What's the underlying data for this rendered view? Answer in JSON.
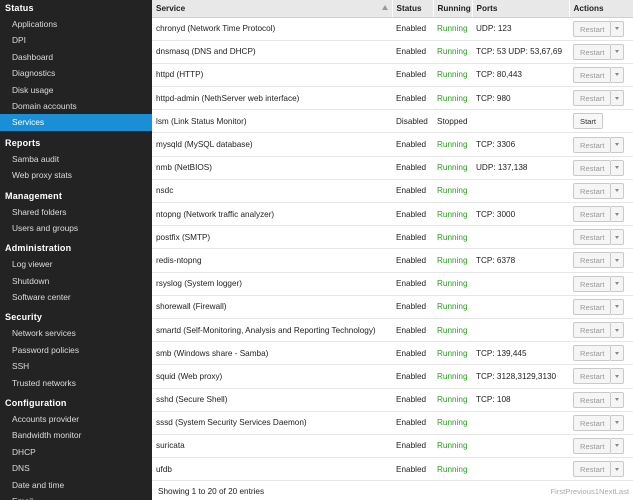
{
  "sidebar": {
    "sections": [
      {
        "title": "Status",
        "items": [
          {
            "label": "Applications"
          },
          {
            "label": "DPI"
          },
          {
            "label": "Dashboard"
          },
          {
            "label": "Diagnostics"
          },
          {
            "label": "Disk usage"
          },
          {
            "label": "Domain accounts"
          },
          {
            "label": "Services",
            "active": true
          }
        ]
      },
      {
        "title": "Reports",
        "items": [
          {
            "label": "Samba audit"
          },
          {
            "label": "Web proxy stats"
          }
        ]
      },
      {
        "title": "Management",
        "items": [
          {
            "label": "Shared folders"
          },
          {
            "label": "Users and groups"
          }
        ]
      },
      {
        "title": "Administration",
        "items": [
          {
            "label": "Log viewer"
          },
          {
            "label": "Shutdown"
          },
          {
            "label": "Software center"
          }
        ]
      },
      {
        "title": "Security",
        "items": [
          {
            "label": "Network services"
          },
          {
            "label": "Password policies"
          },
          {
            "label": "SSH"
          },
          {
            "label": "Trusted networks"
          }
        ]
      },
      {
        "title": "Configuration",
        "items": [
          {
            "label": "Accounts provider"
          },
          {
            "label": "Bandwidth monitor"
          },
          {
            "label": "DHCP"
          },
          {
            "label": "DNS"
          },
          {
            "label": "Date and time"
          },
          {
            "label": "Email"
          }
        ]
      }
    ]
  },
  "table": {
    "headers": {
      "service": "Service",
      "status": "Status",
      "running": "Running",
      "ports": "Ports",
      "actions": "Actions"
    },
    "rows": [
      {
        "service": "chronyd (Network Time Protocol)",
        "status": "Enabled",
        "running": "Running",
        "ports": "UDP: 123",
        "action": "Restart"
      },
      {
        "service": "dnsmasq (DNS and DHCP)",
        "status": "Enabled",
        "running": "Running",
        "ports": "TCP: 53 UDP: 53,67,69",
        "action": "Restart"
      },
      {
        "service": "httpd (HTTP)",
        "status": "Enabled",
        "running": "Running",
        "ports": "TCP: 80,443",
        "action": "Restart"
      },
      {
        "service": "httpd-admin (NethServer web interface)",
        "status": "Enabled",
        "running": "Running",
        "ports": "TCP: 980",
        "action": "Restart"
      },
      {
        "service": "lsm (Link Status Monitor)",
        "status": "Disabled",
        "running": "Stopped",
        "ports": "",
        "action": "Start"
      },
      {
        "service": "mysqld (MySQL database)",
        "status": "Enabled",
        "running": "Running",
        "ports": "TCP: 3306",
        "action": "Restart"
      },
      {
        "service": "nmb (NetBIOS)",
        "status": "Enabled",
        "running": "Running",
        "ports": "UDP: 137,138",
        "action": "Restart"
      },
      {
        "service": "nsdc",
        "status": "Enabled",
        "running": "Running",
        "ports": "",
        "action": "Restart"
      },
      {
        "service": "ntopng (Network traffic analyzer)",
        "status": "Enabled",
        "running": "Running",
        "ports": "TCP: 3000",
        "action": "Restart"
      },
      {
        "service": "postfix (SMTP)",
        "status": "Enabled",
        "running": "Running",
        "ports": "",
        "action": "Restart"
      },
      {
        "service": "redis-ntopng",
        "status": "Enabled",
        "running": "Running",
        "ports": "TCP: 6378",
        "action": "Restart"
      },
      {
        "service": "rsyslog (System logger)",
        "status": "Enabled",
        "running": "Running",
        "ports": "",
        "action": "Restart"
      },
      {
        "service": "shorewall (Firewall)",
        "status": "Enabled",
        "running": "Running",
        "ports": "",
        "action": "Restart"
      },
      {
        "service": "smartd (Self-Monitoring, Analysis and Reporting Technology)",
        "status": "Enabled",
        "running": "Running",
        "ports": "",
        "action": "Restart"
      },
      {
        "service": "smb (Windows share - Samba)",
        "status": "Enabled",
        "running": "Running",
        "ports": "TCP: 139,445",
        "action": "Restart"
      },
      {
        "service": "squid (Web proxy)",
        "status": "Enabled",
        "running": "Running",
        "ports": "TCP: 3128,3129,3130",
        "action": "Restart"
      },
      {
        "service": "sshd (Secure Shell)",
        "status": "Enabled",
        "running": "Running",
        "ports": "TCP: 108",
        "action": "Restart"
      },
      {
        "service": "sssd (System Security Services Daemon)",
        "status": "Enabled",
        "running": "Running",
        "ports": "",
        "action": "Restart"
      },
      {
        "service": "suricata",
        "status": "Enabled",
        "running": "Running",
        "ports": "",
        "action": "Restart"
      },
      {
        "service": "ufdb",
        "status": "Enabled",
        "running": "Running",
        "ports": "",
        "action": "Restart"
      }
    ]
  },
  "footer": {
    "info": "Showing 1 to 20 of 20 entries",
    "pager": "FirstPrevious1NextLast"
  },
  "colors": {
    "sidebar_bg": "#232323",
    "active_nav": "#1a8fd6",
    "running": "#2a9d1f"
  }
}
